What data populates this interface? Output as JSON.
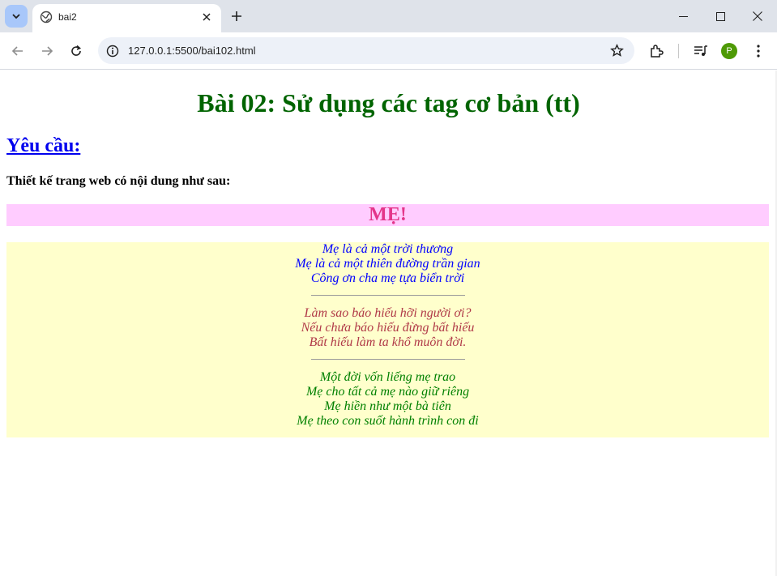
{
  "browser": {
    "tab_title": "bai2",
    "url": "127.0.0.1:5500/bai102.html",
    "profile_initial": "P",
    "icons": [
      "tab-search-icon",
      "globe-icon",
      "close-icon",
      "plus-icon",
      "minimize-icon",
      "maximize-icon",
      "window-close-icon",
      "back-icon",
      "forward-icon",
      "reload-icon",
      "site-info-icon",
      "star-icon",
      "extensions-icon",
      "media-icon",
      "menu-icon"
    ]
  },
  "page": {
    "title": "Bài 02: Sử dụng các tag cơ bản (tt)",
    "requirement_heading": "Yêu cầu:",
    "description": "Thiết kế trang web có nội dung như sau:",
    "poem_title": "MẸ!",
    "stanzas": [
      [
        "Mẹ là cả một trời thương",
        "Mẹ là cả một thiên đường trần gian",
        "Công ơn cha mẹ tựa biển trời"
      ],
      [
        "Làm sao báo hiếu hỡi người ơi?",
        "Nếu chưa báo hiếu đừng bất hiếu",
        "Bất hiếu làm ta khổ muôn đời."
      ],
      [
        "Một đời vốn liếng mẹ trao",
        "Mẹ cho tất cả mẹ nào giữ riêng",
        "Mẹ hiền như một bà tiên",
        "Mẹ theo con suốt hành trình con đi"
      ]
    ]
  },
  "colors": {
    "title": "#006400",
    "link": "#0000ee",
    "poem_title": "#e4368a",
    "poem_title_bg": "#ffccff",
    "poem_bg": "#ffffcc",
    "stanza1": "#0000ff",
    "stanza2": "#b03a48",
    "stanza3": "#008000"
  }
}
